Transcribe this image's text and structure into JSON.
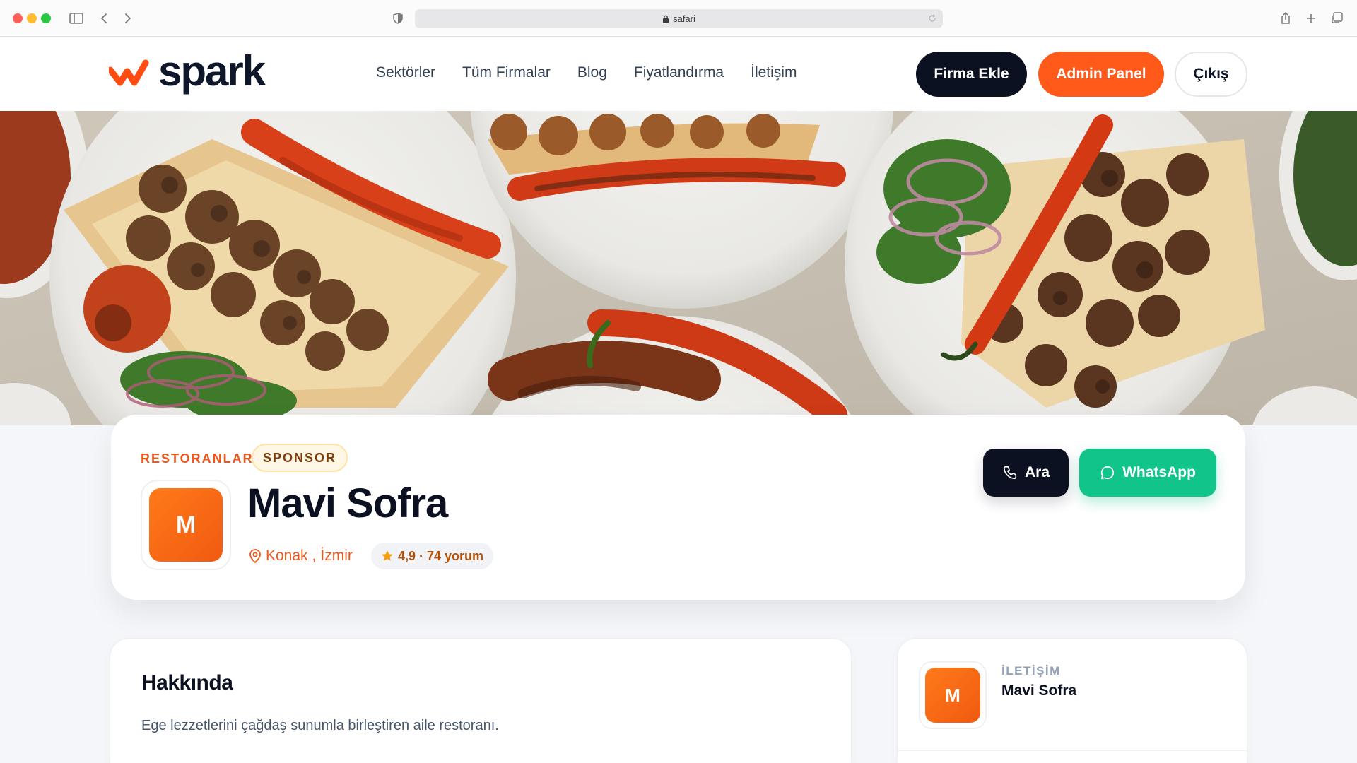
{
  "browser": {
    "url": "safari",
    "icons": [
      "sidebar-icon",
      "back-icon",
      "forward-icon",
      "shield-icon",
      "lock-icon",
      "reload-icon",
      "share-icon",
      "new-tab-icon",
      "tabs-icon"
    ],
    "traffic_colors": [
      "#ff5f57",
      "#febc2e",
      "#28c840"
    ]
  },
  "header": {
    "logo_text": "spark",
    "nav": [
      "Sektörler",
      "Tüm Firmalar",
      "Blog",
      "Fiyatlandırma",
      "İletişim"
    ],
    "add_company": "Firma Ekle",
    "admin_panel": "Admin Panel",
    "logout": "Çıkış"
  },
  "hero": {
    "description": "Kebab plates with grilled peppers, meat and onion salad"
  },
  "profile": {
    "category": "RESTORANLAR",
    "badge": "SPONSOR",
    "avatar_letter": "M",
    "name": "Mavi Sofra",
    "district": "Konak",
    "separator": ",",
    "city": "İzmir",
    "rating_text": "4,9 · 74 yorum",
    "call_label": "Ara",
    "whatsapp_label": "WhatsApp"
  },
  "about": {
    "title": "Hakkında",
    "text": "Ege lezzetlerini çağdaş sunumla birleştiren aile restoranı."
  },
  "contact": {
    "avatar_letter": "M",
    "label": "İLETİŞİM",
    "name": "Mavi Sofra"
  },
  "colors": {
    "accent_orange": "#ff5a1a",
    "dark": "#0b1120",
    "whatsapp_green": "#10c48a"
  }
}
